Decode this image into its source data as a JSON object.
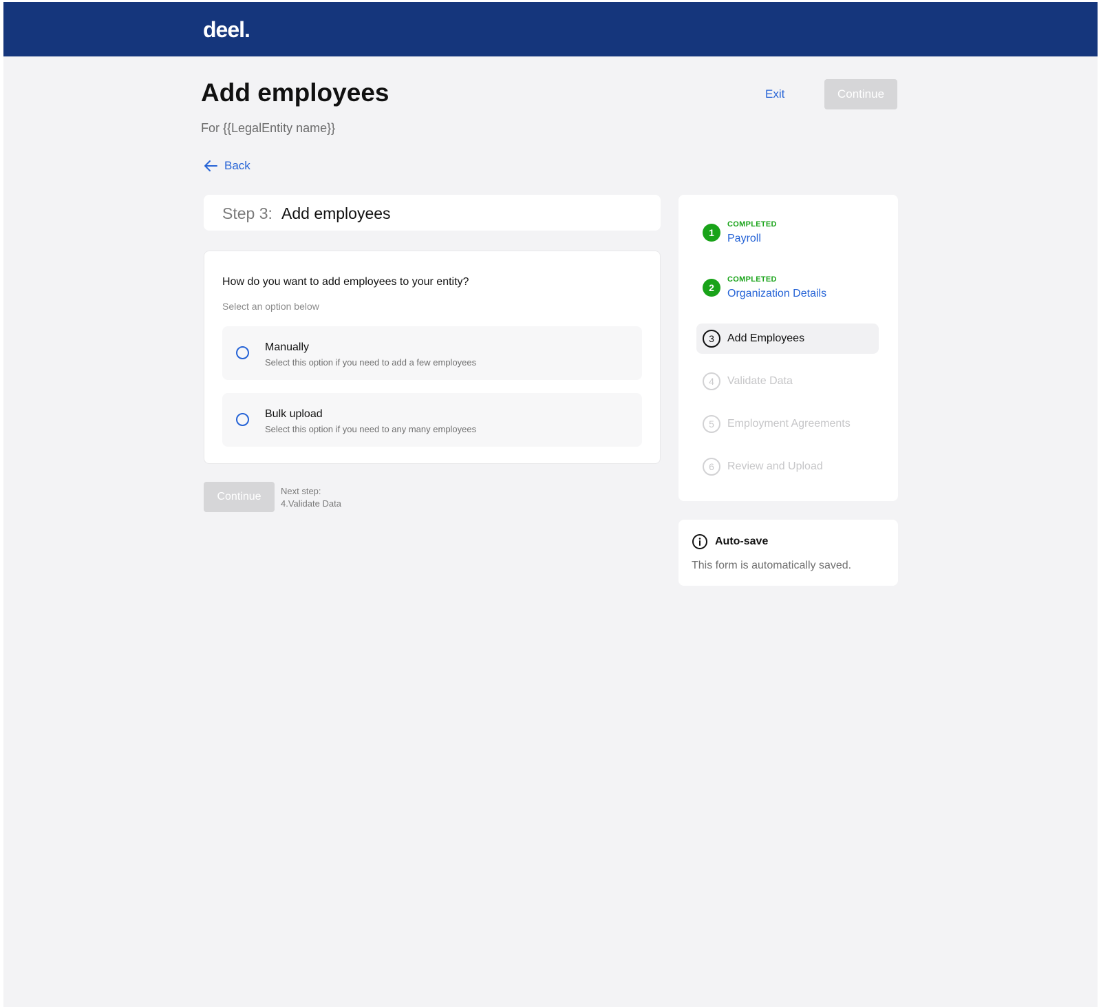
{
  "header": {
    "logo": "deel."
  },
  "page": {
    "title": "Add employees",
    "subtitle": "For {{LegalEntity name}}",
    "exit_label": "Exit",
    "continue_label": "Continue",
    "back_label": "Back"
  },
  "step_header": {
    "step_label": "Step 3:",
    "step_name": "Add employees"
  },
  "question_card": {
    "question": "How do you want to add employees to your entity?",
    "hint": "Select an option below",
    "options": [
      {
        "title": "Manually",
        "description": "Select this option if you need to add a few employees"
      },
      {
        "title": "Bulk upload",
        "description": "Select this option if you need to any many employees"
      }
    ]
  },
  "footer": {
    "continue_label": "Continue",
    "next_step_label": "Next step:",
    "next_step_value": "4.Validate Data"
  },
  "stepper": {
    "steps": [
      {
        "number": "1",
        "status": "COMPLETED",
        "name": "Payroll"
      },
      {
        "number": "2",
        "status": "COMPLETED",
        "name": "Organization Details"
      },
      {
        "number": "3",
        "name": "Add Employees"
      },
      {
        "number": "4",
        "name": "Validate Data"
      },
      {
        "number": "5",
        "name": "Employment Agreements"
      },
      {
        "number": "6",
        "name": "Review and Upload"
      }
    ]
  },
  "autosave": {
    "title": "Auto-save",
    "text": "This form is automatically saved."
  },
  "colors": {
    "brand": "#15367c",
    "link": "#2563d6",
    "completed": "#19a319",
    "disabled_button": "#d6d6d8"
  }
}
